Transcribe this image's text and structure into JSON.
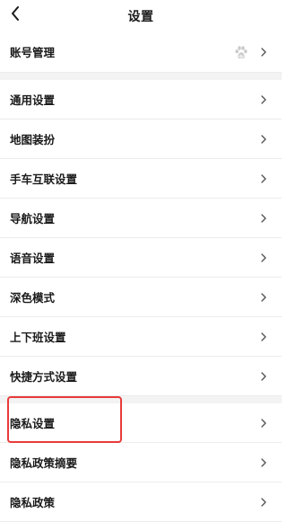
{
  "header": {
    "title": "设置",
    "back_icon": "chevron-left-icon"
  },
  "account": {
    "label": "账号管理",
    "icon": "baidu-paw-icon"
  },
  "items_group1": [
    {
      "label": "通用设置"
    },
    {
      "label": "地图装扮"
    },
    {
      "label": "手车互联设置"
    },
    {
      "label": "导航设置"
    },
    {
      "label": "语音设置"
    },
    {
      "label": "深色模式"
    },
    {
      "label": "上下班设置"
    },
    {
      "label": "快捷方式设置"
    }
  ],
  "items_group2": [
    {
      "label": "隐私设置"
    },
    {
      "label": "隐私政策摘要"
    },
    {
      "label": "隐私政策"
    }
  ],
  "colors": {
    "highlight": "#e83a3a",
    "separator": "#f3f3f3",
    "chevron": "#555555"
  }
}
